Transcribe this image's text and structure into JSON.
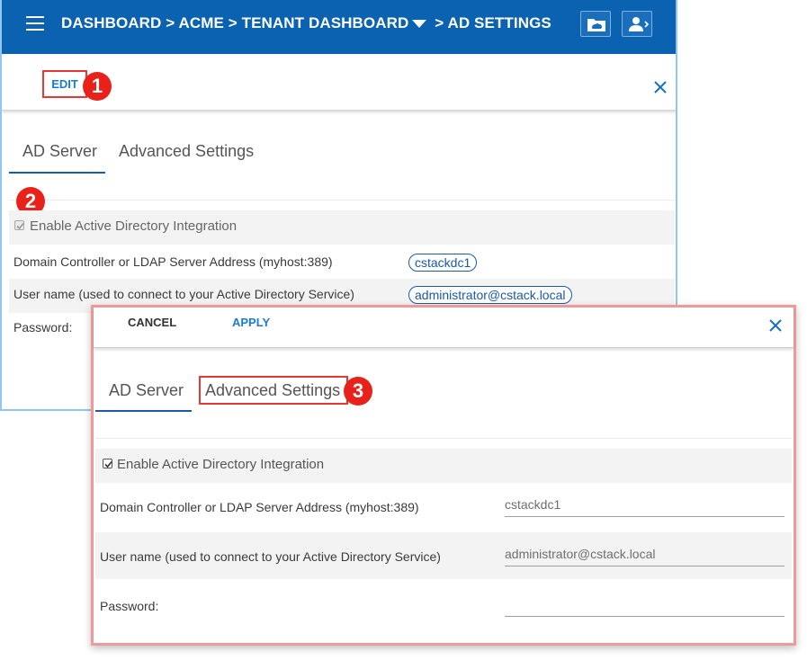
{
  "header": {
    "menu_icon": "hamburger-icon",
    "breadcrumb": {
      "crumb1": "DASHBOARD",
      "sep1": ">",
      "crumb2": "ACME",
      "sep2": ">",
      "crumb3": "TENANT DASHBOARD",
      "sep3": ">",
      "crumb4": "AD SETTINGS"
    },
    "buttons": [
      "folder-icon",
      "user-switch-icon"
    ],
    "color": "#0a62b1"
  },
  "view_panel": {
    "edit_label": "EDIT",
    "badges": [
      "1",
      "2"
    ],
    "tabs": [
      {
        "label": "AD Server"
      },
      {
        "label": "Advanced Settings"
      }
    ],
    "fields": {
      "enable_label": "Enable Active Directory Integration",
      "domain_label": "Domain Controller or LDAP Server Address (myhost:389)",
      "domain_value": "cstackdc1",
      "user_label": "User name (used to connect to your Active Directory Service)",
      "user_value": "administrator@cstack.local",
      "password_label": "Password:"
    }
  },
  "edit_panel": {
    "cancel_label": "CANCEL",
    "apply_label": "APPLY",
    "badge": "3",
    "tabs": [
      {
        "label": "AD Server"
      },
      {
        "label": "Advanced Settings"
      }
    ],
    "fields": {
      "enable_label": "Enable Active Directory Integration",
      "domain_label": "Domain Controller or LDAP Server Address (myhost:389)",
      "domain_value": "cstackdc1",
      "user_label": "User name (used to connect to your Active Directory Service)",
      "user_value": "administrator@cstack.local",
      "password_label": "Password:",
      "password_value": ""
    }
  },
  "colors": {
    "accent": "#1a7bd4",
    "highlight": "#e53935",
    "badge": "#e8211b"
  }
}
